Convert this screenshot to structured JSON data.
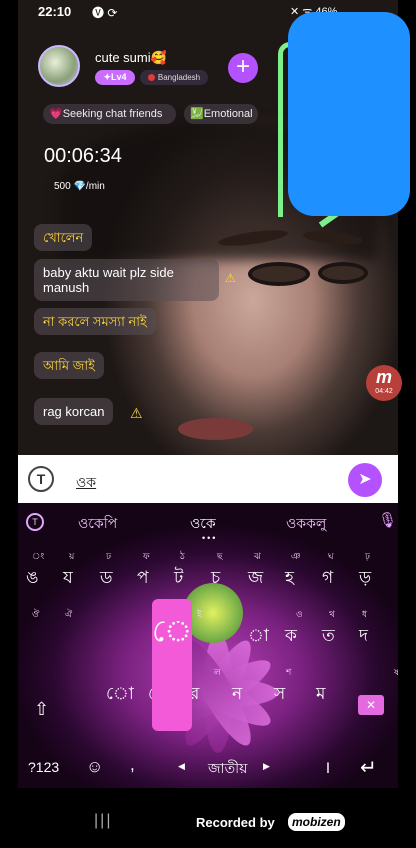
{
  "status_bar": {
    "time": "22:10",
    "left_icons": "🅥 ⟳",
    "right_icons": "✕ ᯤ 46%"
  },
  "host": {
    "name": "cute sumi🥰",
    "level": "✦Lv4",
    "country": "Bangladesh",
    "follow_label": "+"
  },
  "tags": [
    "💗Seeking chat friends",
    "💹Emotional"
  ],
  "timer": "00:06:34",
  "rate": {
    "amount": "500",
    "gem": "💎",
    "unit": "/min"
  },
  "chat_messages": [
    {
      "text": "খোলেন",
      "color": "yellow"
    },
    {
      "text": "baby aktu wait plz side manush",
      "color": "white"
    },
    {
      "text": "না করলে সমস্যা নাই",
      "color": "yellow"
    },
    {
      "text": "আমি জাই",
      "color": "yellow"
    },
    {
      "text": "rag korcan",
      "color": "white"
    }
  ],
  "warning_icon": "⚠",
  "app_badge": {
    "letter": "m",
    "time": "04:42"
  },
  "input": {
    "value": "ওক",
    "send_icon": "➤",
    "translate_icon": "T"
  },
  "keyboard": {
    "suggestion_icon": "T",
    "suggestions": [
      "ওকেপি",
      "ওকে",
      "ওককলু"
    ],
    "mic_icon": "🎙",
    "row1_hints": [
      "ং",
      "য়",
      "ঢ",
      "ফ",
      "ঠ",
      "ছ",
      "ঝ",
      "ঞ",
      "ঘ",
      "ঢ়"
    ],
    "row1_keys": [
      "ঙ",
      "য",
      "ড",
      "প",
      "ট",
      "চ",
      "জ",
      "হ",
      "গ",
      "ড়"
    ],
    "row2_hints": [
      "ঔ",
      "ঐ",
      "",
      "",
      "",
      "ই",
      "",
      "",
      "ও",
      "থ",
      "ধ"
    ],
    "row2_keys": [
      "",
      "",
      "",
      "",
      "",
      "",
      "া",
      "ক",
      "ত",
      "দ"
    ],
    "row3_hints": [
      "",
      "",
      "",
      "ও",
      "ল",
      "",
      "শ",
      "",
      "",
      "ষ"
    ],
    "row3_keys": [
      "",
      "ো",
      "ে",
      "র",
      "ন",
      "স",
      "ম"
    ],
    "popup_key": "ে",
    "shift_icon": "⇧",
    "backspace_icon": "✕",
    "bottom": {
      "numbers": "?123",
      "emoji": "☺",
      "comma": ",",
      "left_arrow": "◀",
      "space": "জাতীয়",
      "right_arrow": "▶",
      "period": "।",
      "enter": "↵"
    }
  },
  "navbar": {
    "recents": "|||",
    "recorded_by": "Recorded by",
    "brand": "mobizen"
  }
}
